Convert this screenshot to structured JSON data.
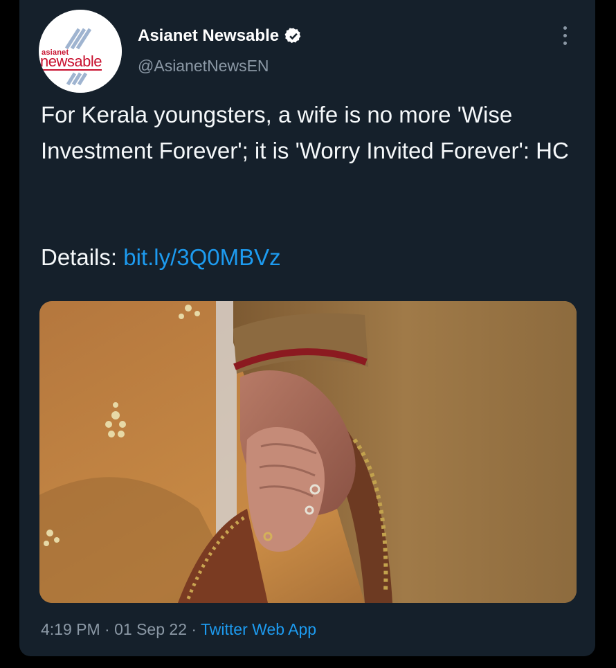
{
  "account": {
    "display_name": "Asianet Newsable",
    "handle": "@AsianetNewsEN",
    "verified": true,
    "avatar_logo_top": "asianet",
    "avatar_logo_bottom": "newsable"
  },
  "tweet": {
    "text": "For Kerala youngsters, a wife is no more 'Wise Investment Forever'; it is 'Worry Invited Forever': HC",
    "details_label": "Details:",
    "link_text": "bit.ly/3Q0MBVz",
    "time": "4:19 PM",
    "date": "01 Sep 22",
    "source": "Twitter Web App",
    "separator": "·"
  },
  "icons": {
    "verified": "verified-badge-icon",
    "more": "more-options-icon"
  },
  "colors": {
    "background": "#15202b",
    "link": "#1d9bf0",
    "muted": "#8b98a5",
    "brand_red": "#c8102e"
  }
}
